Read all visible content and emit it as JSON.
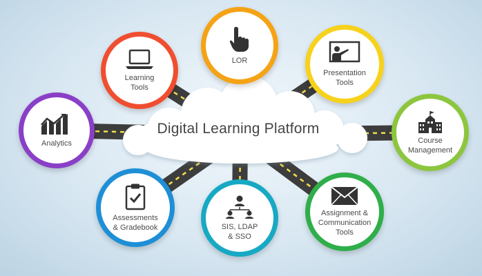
{
  "diagram": {
    "center_title": "Digital Learning Platform",
    "nodes": [
      {
        "id": "learning-tools",
        "label": "Learning\nTools",
        "color": "#f04e30",
        "icon": "laptop-icon"
      },
      {
        "id": "lor",
        "label": "LOR",
        "color": "#f5a316",
        "icon": "pointing-hand-icon"
      },
      {
        "id": "presentation-tools",
        "label": "Presentation\nTools",
        "color": "#f7d21c",
        "icon": "presenter-board-icon"
      },
      {
        "id": "analytics",
        "label": "Analytics",
        "color": "#8a3fc7",
        "icon": "chart-up-icon"
      },
      {
        "id": "course-management",
        "label": "Course\nManagement",
        "color": "#8cc63e",
        "icon": "school-building-icon"
      },
      {
        "id": "assessments-gradebook",
        "label": "Assessments\n& Gradebook",
        "color": "#1e8fd6",
        "icon": "clipboard-check-icon"
      },
      {
        "id": "sis-ldap-sso",
        "label": "SIS, LDAP\n& SSO",
        "color": "#17a9c4",
        "icon": "users-network-icon"
      },
      {
        "id": "assignment-communication",
        "label": "Assignment &\nCommunication\nTools",
        "color": "#2fae4a",
        "icon": "envelope-icon"
      }
    ],
    "colors": {
      "road": "#3d3d3d",
      "road_dash": "#f5e04a",
      "cloud": "#ffffff",
      "text": "#4a4a4a",
      "icon": "#333333"
    }
  }
}
